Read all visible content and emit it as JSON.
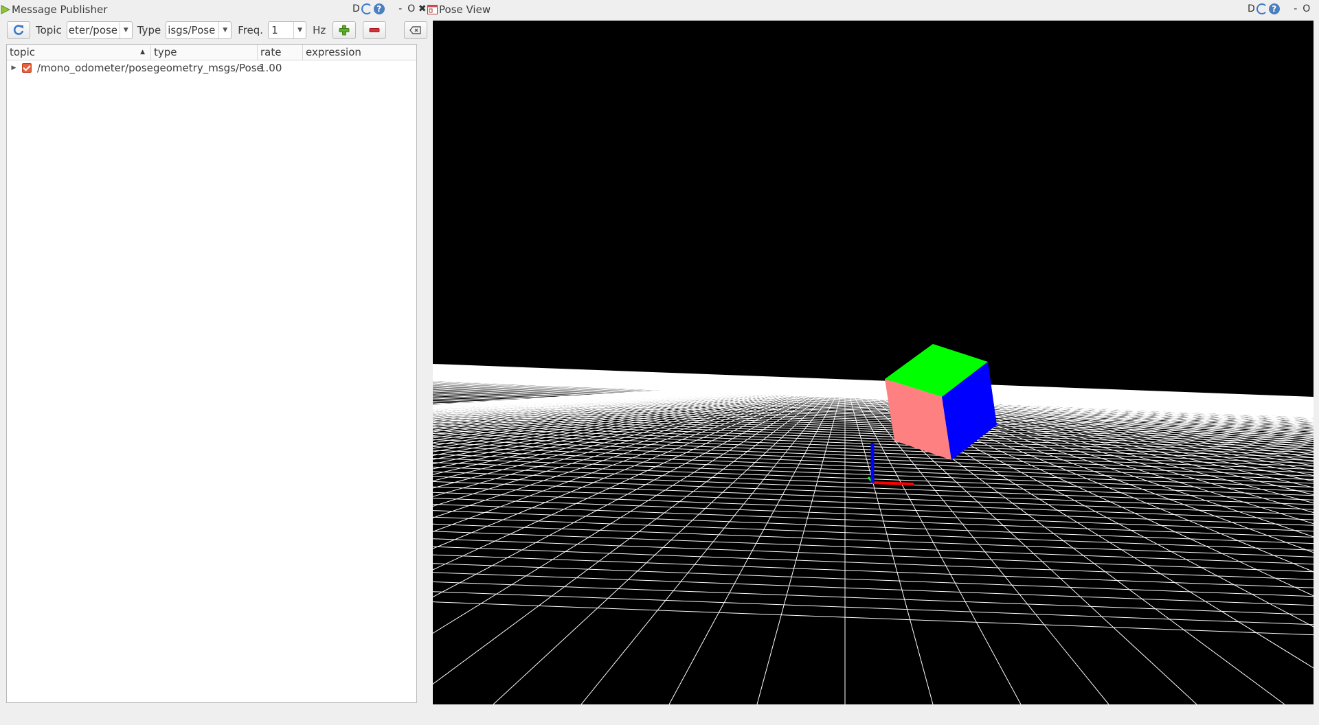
{
  "message_publisher": {
    "title": "Message Publisher",
    "toolbar": {
      "topic_label": "Topic",
      "topic_value": "eter/pose",
      "type_label": "Type",
      "type_value": "isgs/Pose",
      "freq_label": "Freq.",
      "freq_value": "1",
      "hz_label": "Hz"
    },
    "table": {
      "columns": [
        "topic",
        "type",
        "rate",
        "expression"
      ],
      "rows": [
        {
          "topic": "/mono_odometer/pose",
          "type": "geometry_msgs/Pose",
          "rate": "1.00",
          "expression": ""
        }
      ]
    },
    "dock_buttons": {
      "d": "D",
      "help": "?",
      "min": "-",
      "float": "O",
      "close": "✖"
    }
  },
  "pose_view": {
    "title": "Pose View",
    "dock_buttons": {
      "d": "D",
      "help": "?",
      "min": "-",
      "float": "O"
    }
  },
  "colors": {
    "cube_top": "#00ff00",
    "cube_front": "#ff8080",
    "cube_side": "#0000ff",
    "axis_x": "#ff0000",
    "axis_y": "#00ff00",
    "axis_z": "#0000ff",
    "grid": "#ffffff",
    "background": "#000000"
  }
}
